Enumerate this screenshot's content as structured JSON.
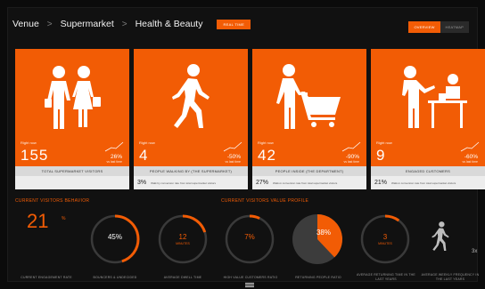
{
  "header": {
    "breadcrumb": [
      "Venue",
      "Supermarket",
      "Health & Beauty"
    ],
    "separator": ">",
    "realtime_label": "REAL TIME",
    "toggle": {
      "overview": "OVERVIEW",
      "heatmap": "HEATMAP"
    }
  },
  "cards": [
    {
      "icon": "family-shopping-icon",
      "realtime": "Right now",
      "value": "155",
      "change": "26%",
      "change_sub": "vs last time",
      "label": "TOTAL SUPERMARKET VISITORS",
      "footer_pct": "",
      "footer_note": ""
    },
    {
      "icon": "walking-person-icon",
      "realtime": "Right now",
      "value": "4",
      "change": "-50%",
      "change_sub": "vs last time",
      "label": "PEOPLE WALKING BY (THE SUPERMARKET)",
      "footer_pct": "3%",
      "footer_note": "Walk by conversion rate from total supermarket visitors"
    },
    {
      "icon": "shopping-cart-person-icon",
      "realtime": "Right now",
      "value": "42",
      "change": "-90%",
      "change_sub": "vs last time",
      "label": "PEOPLE INSIDE (THE DEPARTMENT)",
      "footer_pct": "27%",
      "footer_note": "Walk-in conversion rate from total supermarket visitors"
    },
    {
      "icon": "customer-service-counter-icon",
      "realtime": "Right now",
      "value": "9",
      "change": "-60%",
      "change_sub": "vs last time",
      "label": "ENGAGED CUSTOMERS",
      "footer_pct": "21%",
      "footer_note": "Walk-in conversion rate from total supermarket visitors"
    }
  ],
  "behavior": {
    "title": "CURRENT VISITORS BEHAVIOR",
    "engagement_value": "21",
    "engagement_unit": "%",
    "metrics": [
      {
        "value": "45%",
        "unit": "",
        "label": "BOUNCERS & UNDECIDED",
        "fraction": 0.45
      },
      {
        "value": "12",
        "unit": "MINUTES",
        "label": "AVERAGE DWELL TIME",
        "fraction": 0.2
      }
    ],
    "engagement_label": "CURRENT ENGAGEMENT RATE"
  },
  "value_profile": {
    "title": "CURRENT VISITORS VALUE PROFILE",
    "metrics": [
      {
        "value": "7%",
        "unit": "",
        "label": "HIGH VALUE CUSTOMERS RATIO",
        "fraction": 0.07
      },
      {
        "value": "38%",
        "unit": "",
        "label": "RETURNING PEOPLE RATIO",
        "fraction": 0.38,
        "style": "pie"
      },
      {
        "value": "3",
        "unit": "MINUTES",
        "label": "AVERAGE RETURNING TIME IN THE LAST YEARS",
        "fraction": 0.1
      }
    ],
    "frequency_value": "3x",
    "frequency_label": "AVERAGE WEEKLY FREQUENCY IN THE LAST YEARS"
  },
  "colors": {
    "accent": "#f25c05",
    "background": "#111111",
    "track": "#3a3a3a"
  }
}
